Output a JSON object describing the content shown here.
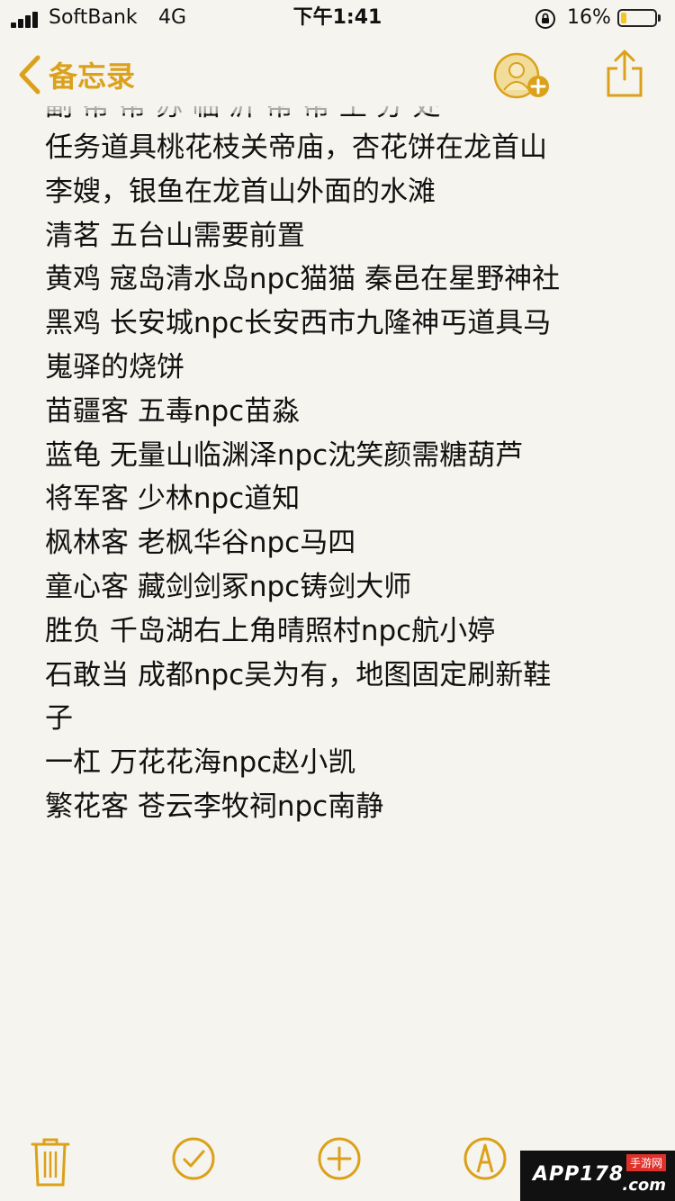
{
  "status_bar": {
    "carrier": "SoftBank",
    "network": "4G",
    "time": "下午1:41",
    "battery_percent": "16%",
    "battery_level": 0.16
  },
  "nav": {
    "back_label": "备忘录"
  },
  "note": {
    "partial_top_line": "副 帮   帮 苏 临 沂 帮 帮 王 分 处",
    "lines": [
      "任务道具桃花枝关帝庙，杏花饼在龙首山",
      "李嫂，银鱼在龙首山外面的水滩",
      "清茗 五台山需要前置",
      "黄鸡 寇岛清水岛npc猫猫 秦邑在星野神社",
      "黑鸡 长安城npc长安西市九隆神丐道具马",
      "嵬驿的烧饼",
      "苗疆客 五毒npc苗淼",
      "蓝龟 无量山临渊泽npc沈笑颜需糖葫芦",
      "将军客 少林npc道知",
      "枫林客 老枫华谷npc马四",
      "童心客 藏剑剑冢npc铸剑大师",
      "胜负 千岛湖右上角晴照村npc航小婷",
      "石敢当 成都npc吴为有，地图固定刷新鞋",
      "子",
      "一杠 万花花海npc赵小凯",
      "繁花客 苍云李牧祠npc南静"
    ]
  },
  "watermark": {
    "text": "APP178",
    "brand": "手游网",
    "domain": ".com"
  },
  "colors": {
    "accent": "#dba11b",
    "background": "#f6f4ee",
    "text": "#111111"
  },
  "icons": {
    "back": "chevron-left-icon",
    "add_person": "add-person-icon",
    "share": "share-icon",
    "delete": "trash-icon",
    "checklist": "checkmark-circle-icon",
    "add": "plus-circle-icon",
    "draw": "pen-circle-icon"
  }
}
